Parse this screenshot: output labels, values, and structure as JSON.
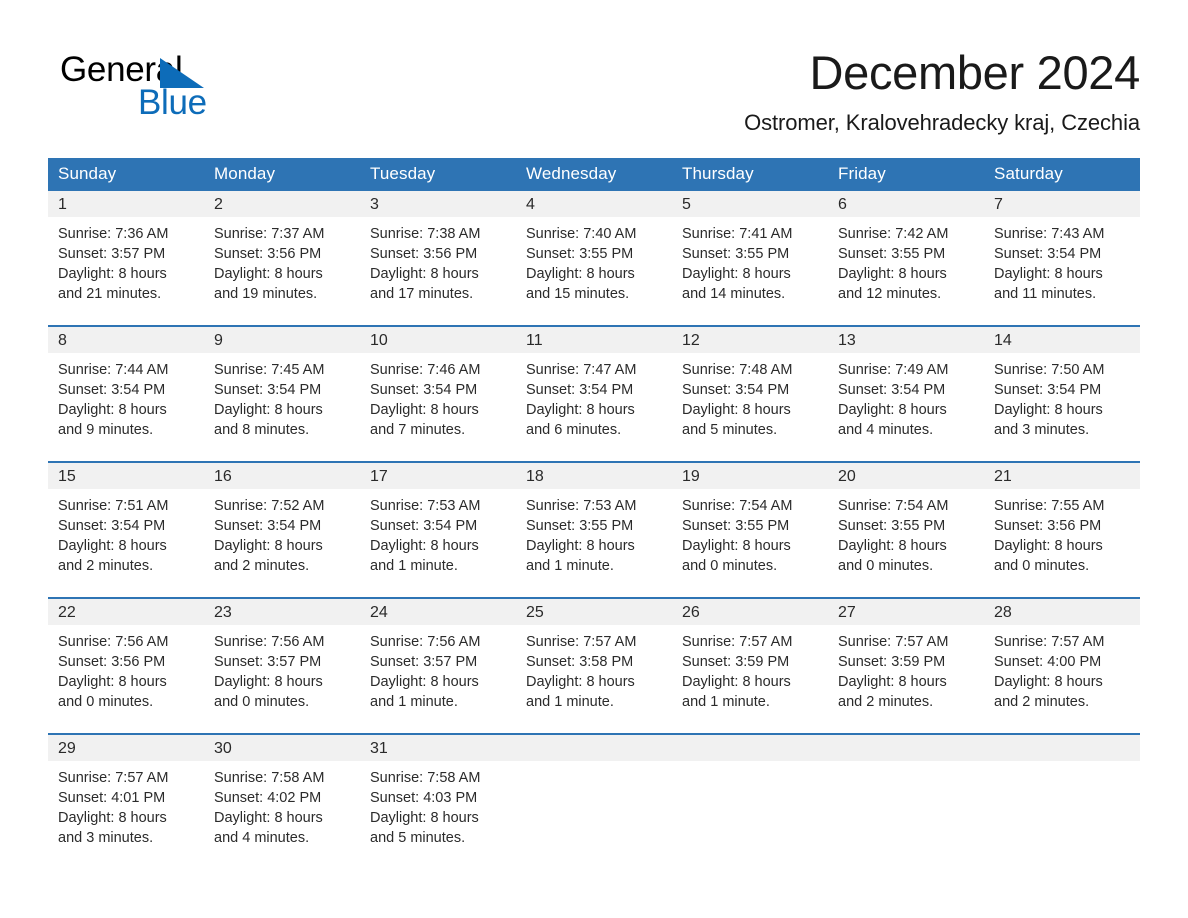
{
  "brand": {
    "name_part1": "General",
    "name_part2": "Blue",
    "triangle_color": "#0d6cb9",
    "text_color": "#000000"
  },
  "header": {
    "title": "December 2024",
    "location": "Ostromer, Kralovehradecky kraj, Czechia"
  },
  "theme": {
    "header_blue": "#2e74b4",
    "daynum_gray": "#f1f1f1",
    "text": "#2b2b2b"
  },
  "weekday_headers": [
    "Sunday",
    "Monday",
    "Tuesday",
    "Wednesday",
    "Thursday",
    "Friday",
    "Saturday"
  ],
  "labels": {
    "sunrise_prefix": "Sunrise:",
    "sunset_prefix": "Sunset:",
    "daylight_prefix": "Daylight:"
  },
  "weeks": [
    [
      {
        "day": "1",
        "sunrise": "Sunrise: 7:36 AM",
        "sunset": "Sunset: 3:57 PM",
        "daylight_l1": "Daylight: 8 hours",
        "daylight_l2": "and 21 minutes."
      },
      {
        "day": "2",
        "sunrise": "Sunrise: 7:37 AM",
        "sunset": "Sunset: 3:56 PM",
        "daylight_l1": "Daylight: 8 hours",
        "daylight_l2": "and 19 minutes."
      },
      {
        "day": "3",
        "sunrise": "Sunrise: 7:38 AM",
        "sunset": "Sunset: 3:56 PM",
        "daylight_l1": "Daylight: 8 hours",
        "daylight_l2": "and 17 minutes."
      },
      {
        "day": "4",
        "sunrise": "Sunrise: 7:40 AM",
        "sunset": "Sunset: 3:55 PM",
        "daylight_l1": "Daylight: 8 hours",
        "daylight_l2": "and 15 minutes."
      },
      {
        "day": "5",
        "sunrise": "Sunrise: 7:41 AM",
        "sunset": "Sunset: 3:55 PM",
        "daylight_l1": "Daylight: 8 hours",
        "daylight_l2": "and 14 minutes."
      },
      {
        "day": "6",
        "sunrise": "Sunrise: 7:42 AM",
        "sunset": "Sunset: 3:55 PM",
        "daylight_l1": "Daylight: 8 hours",
        "daylight_l2": "and 12 minutes."
      },
      {
        "day": "7",
        "sunrise": "Sunrise: 7:43 AM",
        "sunset": "Sunset: 3:54 PM",
        "daylight_l1": "Daylight: 8 hours",
        "daylight_l2": "and 11 minutes."
      }
    ],
    [
      {
        "day": "8",
        "sunrise": "Sunrise: 7:44 AM",
        "sunset": "Sunset: 3:54 PM",
        "daylight_l1": "Daylight: 8 hours",
        "daylight_l2": "and 9 minutes."
      },
      {
        "day": "9",
        "sunrise": "Sunrise: 7:45 AM",
        "sunset": "Sunset: 3:54 PM",
        "daylight_l1": "Daylight: 8 hours",
        "daylight_l2": "and 8 minutes."
      },
      {
        "day": "10",
        "sunrise": "Sunrise: 7:46 AM",
        "sunset": "Sunset: 3:54 PM",
        "daylight_l1": "Daylight: 8 hours",
        "daylight_l2": "and 7 minutes."
      },
      {
        "day": "11",
        "sunrise": "Sunrise: 7:47 AM",
        "sunset": "Sunset: 3:54 PM",
        "daylight_l1": "Daylight: 8 hours",
        "daylight_l2": "and 6 minutes."
      },
      {
        "day": "12",
        "sunrise": "Sunrise: 7:48 AM",
        "sunset": "Sunset: 3:54 PM",
        "daylight_l1": "Daylight: 8 hours",
        "daylight_l2": "and 5 minutes."
      },
      {
        "day": "13",
        "sunrise": "Sunrise: 7:49 AM",
        "sunset": "Sunset: 3:54 PM",
        "daylight_l1": "Daylight: 8 hours",
        "daylight_l2": "and 4 minutes."
      },
      {
        "day": "14",
        "sunrise": "Sunrise: 7:50 AM",
        "sunset": "Sunset: 3:54 PM",
        "daylight_l1": "Daylight: 8 hours",
        "daylight_l2": "and 3 minutes."
      }
    ],
    [
      {
        "day": "15",
        "sunrise": "Sunrise: 7:51 AM",
        "sunset": "Sunset: 3:54 PM",
        "daylight_l1": "Daylight: 8 hours",
        "daylight_l2": "and 2 minutes."
      },
      {
        "day": "16",
        "sunrise": "Sunrise: 7:52 AM",
        "sunset": "Sunset: 3:54 PM",
        "daylight_l1": "Daylight: 8 hours",
        "daylight_l2": "and 2 minutes."
      },
      {
        "day": "17",
        "sunrise": "Sunrise: 7:53 AM",
        "sunset": "Sunset: 3:54 PM",
        "daylight_l1": "Daylight: 8 hours",
        "daylight_l2": "and 1 minute."
      },
      {
        "day": "18",
        "sunrise": "Sunrise: 7:53 AM",
        "sunset": "Sunset: 3:55 PM",
        "daylight_l1": "Daylight: 8 hours",
        "daylight_l2": "and 1 minute."
      },
      {
        "day": "19",
        "sunrise": "Sunrise: 7:54 AM",
        "sunset": "Sunset: 3:55 PM",
        "daylight_l1": "Daylight: 8 hours",
        "daylight_l2": "and 0 minutes."
      },
      {
        "day": "20",
        "sunrise": "Sunrise: 7:54 AM",
        "sunset": "Sunset: 3:55 PM",
        "daylight_l1": "Daylight: 8 hours",
        "daylight_l2": "and 0 minutes."
      },
      {
        "day": "21",
        "sunrise": "Sunrise: 7:55 AM",
        "sunset": "Sunset: 3:56 PM",
        "daylight_l1": "Daylight: 8 hours",
        "daylight_l2": "and 0 minutes."
      }
    ],
    [
      {
        "day": "22",
        "sunrise": "Sunrise: 7:56 AM",
        "sunset": "Sunset: 3:56 PM",
        "daylight_l1": "Daylight: 8 hours",
        "daylight_l2": "and 0 minutes."
      },
      {
        "day": "23",
        "sunrise": "Sunrise: 7:56 AM",
        "sunset": "Sunset: 3:57 PM",
        "daylight_l1": "Daylight: 8 hours",
        "daylight_l2": "and 0 minutes."
      },
      {
        "day": "24",
        "sunrise": "Sunrise: 7:56 AM",
        "sunset": "Sunset: 3:57 PM",
        "daylight_l1": "Daylight: 8 hours",
        "daylight_l2": "and 1 minute."
      },
      {
        "day": "25",
        "sunrise": "Sunrise: 7:57 AM",
        "sunset": "Sunset: 3:58 PM",
        "daylight_l1": "Daylight: 8 hours",
        "daylight_l2": "and 1 minute."
      },
      {
        "day": "26",
        "sunrise": "Sunrise: 7:57 AM",
        "sunset": "Sunset: 3:59 PM",
        "daylight_l1": "Daylight: 8 hours",
        "daylight_l2": "and 1 minute."
      },
      {
        "day": "27",
        "sunrise": "Sunrise: 7:57 AM",
        "sunset": "Sunset: 3:59 PM",
        "daylight_l1": "Daylight: 8 hours",
        "daylight_l2": "and 2 minutes."
      },
      {
        "day": "28",
        "sunrise": "Sunrise: 7:57 AM",
        "sunset": "Sunset: 4:00 PM",
        "daylight_l1": "Daylight: 8 hours",
        "daylight_l2": "and 2 minutes."
      }
    ],
    [
      {
        "day": "29",
        "sunrise": "Sunrise: 7:57 AM",
        "sunset": "Sunset: 4:01 PM",
        "daylight_l1": "Daylight: 8 hours",
        "daylight_l2": "and 3 minutes."
      },
      {
        "day": "30",
        "sunrise": "Sunrise: 7:58 AM",
        "sunset": "Sunset: 4:02 PM",
        "daylight_l1": "Daylight: 8 hours",
        "daylight_l2": "and 4 minutes."
      },
      {
        "day": "31",
        "sunrise": "Sunrise: 7:58 AM",
        "sunset": "Sunset: 4:03 PM",
        "daylight_l1": "Daylight: 8 hours",
        "daylight_l2": "and 5 minutes."
      },
      {
        "day": "",
        "sunrise": "",
        "sunset": "",
        "daylight_l1": "",
        "daylight_l2": ""
      },
      {
        "day": "",
        "sunrise": "",
        "sunset": "",
        "daylight_l1": "",
        "daylight_l2": ""
      },
      {
        "day": "",
        "sunrise": "",
        "sunset": "",
        "daylight_l1": "",
        "daylight_l2": ""
      },
      {
        "day": "",
        "sunrise": "",
        "sunset": "",
        "daylight_l1": "",
        "daylight_l2": ""
      }
    ]
  ]
}
